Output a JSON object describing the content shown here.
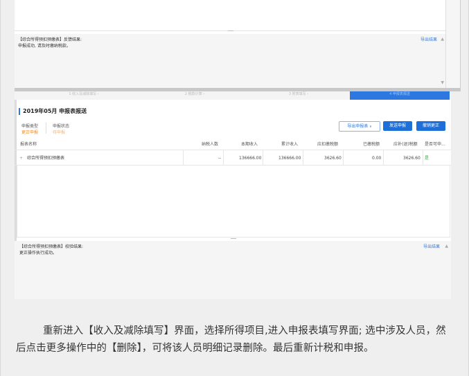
{
  "top_panel": {
    "feedback_line1": "【综合所得预扣预缴表】反馈结果:",
    "feedback_line2": "申报成功, 请及时缴纳税款。",
    "export_link": "导出结果"
  },
  "mid_panel": {
    "tabs": [
      "1 收入及减除填写 ›",
      "2 税款计算 ›",
      "3 附表填写 ›",
      "4 申报表报送"
    ],
    "period_title": "2019年05月  申报表报送",
    "declare_type_label": "申报类型",
    "declare_type_value": "更正申报",
    "declare_status_label": "申报状态",
    "declare_status_value": "待申报",
    "buttons": {
      "export_report": "导出申报表",
      "send_report": "发送申报",
      "cancel_correction": "撤销更正"
    },
    "table": {
      "headers": [
        "报表名称",
        "纳税人数",
        "本期收入",
        "累计收入",
        "应扣缴税额",
        "已缴税额",
        "应补(退)税额",
        "是否可申..."
      ],
      "rows": [
        {
          "name": "综合所得预扣预缴表",
          "count": "--",
          "current_income": "136666.00",
          "cumulative_income": "136666.00",
          "tax_due": "3626.60",
          "tax_paid": "0.00",
          "tax_balance": "3626.60",
          "can_declare": "是"
        }
      ]
    },
    "check_line1": "【综合所得预扣预缴表】校验结果:",
    "check_line2": "更正操作执行成功。",
    "export_link": "导出结果"
  },
  "caption": "重新进入【收入及减除填写】界面，选择所得项目,进入申报表填写界面; 选中涉及人员，然后点击更多操作中的【删除】，可将该人员明细记录删除。最后重新计税和申报。"
}
